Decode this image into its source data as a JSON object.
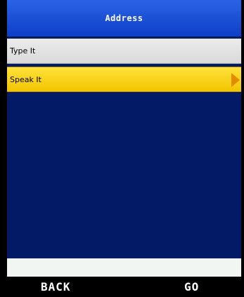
{
  "header": {
    "title": "Address"
  },
  "menu": {
    "items": [
      {
        "label": "Type It"
      },
      {
        "label": "Speak It"
      }
    ]
  },
  "softkeys": {
    "left": "BACK",
    "right": "GO"
  },
  "colors": {
    "title_bar": "#1a4fd6",
    "background": "#031a66",
    "selected_item": "#f8d21c",
    "item": "#e3e3e3",
    "arrow": "#e38a00"
  },
  "icons": {
    "selected_arrow": "right-triangle-icon"
  }
}
